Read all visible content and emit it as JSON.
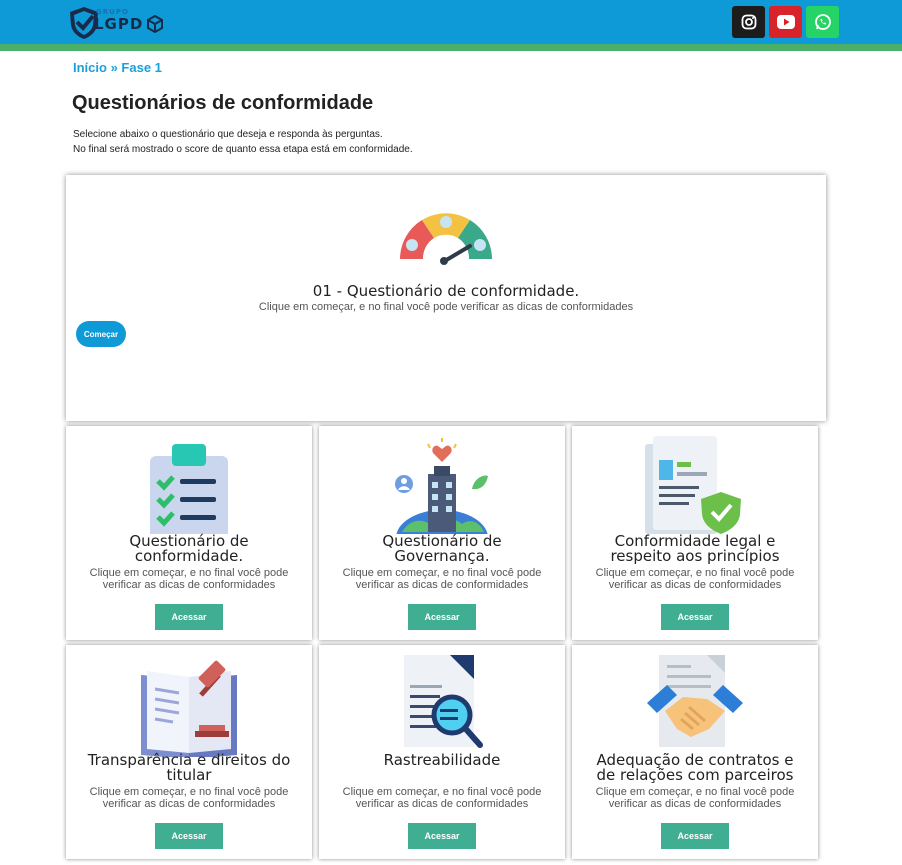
{
  "header": {
    "logo_small": "GRUPO",
    "logo_text": "LGPD",
    "social": [
      "instagram-icon",
      "youtube-icon",
      "whatsapp-icon"
    ],
    "colors": {
      "topbar": "#0d9ad6",
      "stripe": "#4caf68"
    }
  },
  "breadcrumb": {
    "home": "Início",
    "separator": " » ",
    "current": "Fase 1"
  },
  "page": {
    "title": "Questionários de conformidade",
    "intro_line1": "Selecione abaixo o questionário que deseja e responda às perguntas.",
    "intro_line2": "No final será mostrado o score de quanto essa etapa está em conformidade."
  },
  "hero": {
    "title": "01 - Questionário de conformidade.",
    "subtitle": "Clique em começar, e no final você pode verificar as dicas de conformidades",
    "button": "Começar"
  },
  "cards": [
    {
      "title1": "Questionário de",
      "title2": "conformidade.",
      "sub1": "Clique em começar, e no final você pode",
      "sub2": "verificar as dicas de conformidades",
      "button": "Acessar"
    },
    {
      "title1": "Questionário de",
      "title2": "Governança.",
      "sub1": "Clique em começar, e no final você pode",
      "sub2": "verificar as dicas de conformidades",
      "button": "Acessar"
    },
    {
      "title1": "Conformidade legal e",
      "title2": "respeito aos princípios",
      "sub1": "Clique em começar, e no final você pode",
      "sub2": "verificar as dicas de conformidades",
      "button": "Acessar"
    },
    {
      "title1": "Transparência e direitos do",
      "title2": "titular",
      "sub1": "Clique em começar, e no final você pode",
      "sub2": "verificar as dicas de conformidades",
      "button": "Acessar"
    },
    {
      "title1": "Rastreabilidade",
      "title2": "",
      "sub1": "Clique em começar, e no final você pode",
      "sub2": "verificar as dicas de conformidades",
      "button": "Acessar"
    },
    {
      "title1": "Adequação de contratos e",
      "title2": "de relações com parceiros",
      "sub1": "Clique em começar, e no final você pode",
      "sub2": "verificar as dicas de conformidades",
      "button": "Acessar"
    }
  ]
}
